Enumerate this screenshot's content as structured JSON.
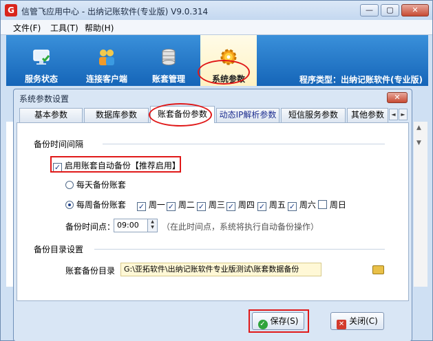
{
  "window": {
    "app_logo": "G",
    "title": "信管飞应用中心 - 出纳记账软件(专业版) V9.0.314",
    "minimize_glyph": "—",
    "maximize_glyph": "▢",
    "close_glyph": "✕"
  },
  "menu": {
    "file": "文件(F)",
    "tools": "工具(T)",
    "help": "帮助(H)"
  },
  "toolbar": {
    "service_status": "服务状态",
    "client_connect": "连接客户端",
    "account_management": "账套管理",
    "system_params": "系统参数",
    "program_type": "程序类型：出纳记账软件(专业版)"
  },
  "dialog": {
    "title": "系统参数设置",
    "close_glyph": "✕",
    "tabs": [
      {
        "label": "基本参数"
      },
      {
        "label": "数据库参数"
      },
      {
        "label": "账套备份参数"
      },
      {
        "label": "动态IP解析参数"
      },
      {
        "label": "短信服务参数"
      },
      {
        "label": "其他参数"
      }
    ],
    "tab_prev": "◄",
    "tab_next": "►",
    "section_interval": "备份时间间隔",
    "enable_auto_backup": "启用账套自动备份【推荐启用】",
    "daily_backup": "每天备份账套",
    "weekly_backup": "每周备份账套",
    "days": [
      {
        "label": "周一",
        "checked": true
      },
      {
        "label": "周二",
        "checked": true
      },
      {
        "label": "周三",
        "checked": true
      },
      {
        "label": "周四",
        "checked": true
      },
      {
        "label": "周五",
        "checked": true
      },
      {
        "label": "周六",
        "checked": true
      },
      {
        "label": "周日",
        "checked": false
      }
    ],
    "backup_time_label": "备份时间点：",
    "backup_time_value": "09:00",
    "backup_time_hint": "（在此时间点，系统将执行自动备份操作）",
    "section_directory": "备份目录设置",
    "backup_dir_label": "账套备份目录",
    "backup_dir_value": "G:\\亚拓软件\\出纳记账软件专业版测试\\账套数据备份",
    "save_button": "保存(S)",
    "close_button": "关闭(C)",
    "checkmark": "✓"
  }
}
